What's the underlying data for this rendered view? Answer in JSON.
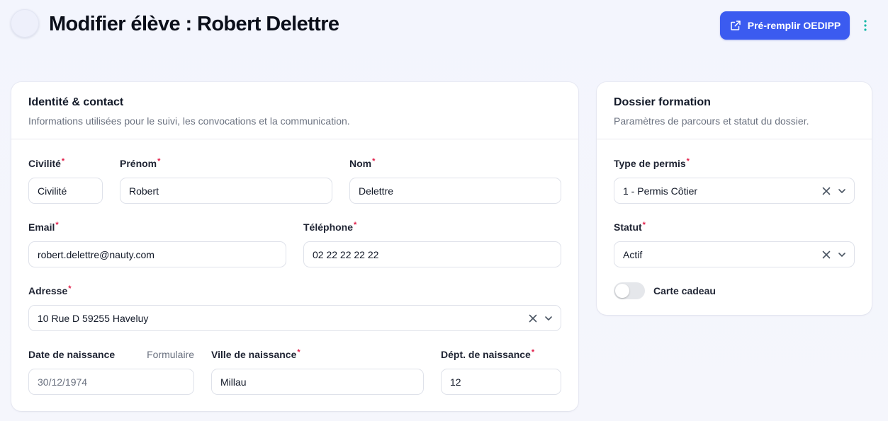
{
  "header": {
    "title": "Modifier élève : Robert Delettre",
    "prefill_button": "Pré-remplir OEDIPP",
    "accent_color": "#3b5bf0"
  },
  "identity": {
    "title": "Identité & contact",
    "description": "Informations utilisées pour le suivi, les convocations et la communication.",
    "civilite": {
      "label": "Civilité",
      "value": "Civilité"
    },
    "prenom": {
      "label": "Prénom",
      "value": "Robert"
    },
    "nom": {
      "label": "Nom",
      "value": "Delettre"
    },
    "email": {
      "label": "Email",
      "value": "robert.delettre@nauty.com"
    },
    "telephone": {
      "label": "Téléphone",
      "value": "02 22 22 22 22"
    },
    "adresse": {
      "label": "Adresse",
      "value": "10 Rue D 59255 Haveluy"
    },
    "date_naissance": {
      "label": "Date de naissance",
      "hint": "Formulaire",
      "value": "30/12/1974"
    },
    "ville_naissance": {
      "label": "Ville de naissance",
      "value": "Millau"
    },
    "dept_naissance": {
      "label": "Dépt. de naissance",
      "value": "12"
    }
  },
  "dossier": {
    "title": "Dossier formation",
    "description": "Paramètres de parcours et statut du dossier.",
    "type_permis": {
      "label": "Type de permis",
      "value": "1 - Permis Côtier"
    },
    "statut": {
      "label": "Statut",
      "value": "Actif"
    },
    "carte_cadeau": {
      "label": "Carte cadeau",
      "checked": false
    }
  },
  "required_marker": "*"
}
